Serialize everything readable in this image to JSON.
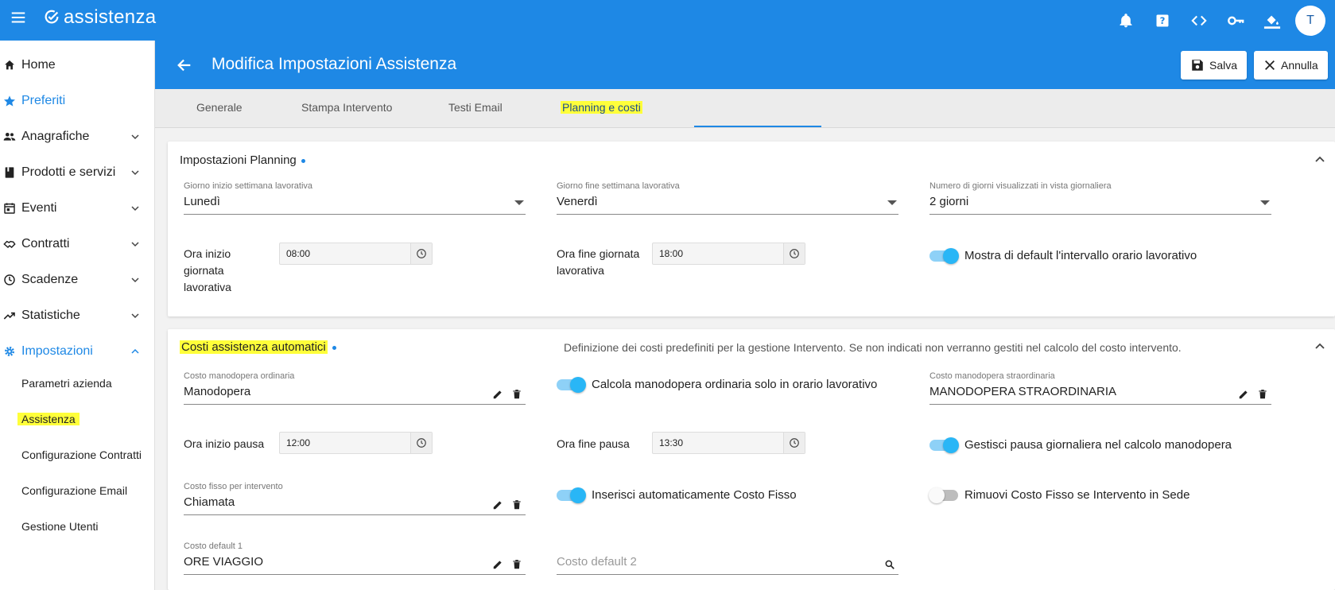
{
  "app": {
    "name": "assistenza",
    "user_initial": "T"
  },
  "sidebar": {
    "items": [
      {
        "label": "Home"
      },
      {
        "label": "Preferiti"
      },
      {
        "label": "Anagrafiche"
      },
      {
        "label": "Prodotti e servizi"
      },
      {
        "label": "Eventi"
      },
      {
        "label": "Contratti"
      },
      {
        "label": "Scadenze"
      },
      {
        "label": "Statistiche"
      },
      {
        "label": "Impostazioni"
      }
    ],
    "subitems": [
      {
        "label": "Parametri azienda"
      },
      {
        "label": "Assistenza"
      },
      {
        "label": "Configurazione Contratti"
      },
      {
        "label": "Configurazione Email"
      },
      {
        "label": "Gestione Utenti"
      }
    ]
  },
  "header": {
    "title": "Modifica Impostazioni Assistenza",
    "save_label": "Salva",
    "cancel_label": "Annulla"
  },
  "tabs": [
    {
      "label": "Generale"
    },
    {
      "label": "Stampa Intervento"
    },
    {
      "label": "Testi Email"
    },
    {
      "label": "Planning e costi"
    }
  ],
  "planning": {
    "title": "Impostazioni Planning",
    "start_day": {
      "label": "Giorno inizio settimana lavorativa",
      "value": "Lunedì"
    },
    "end_day": {
      "label": "Giorno fine settimana lavorativa",
      "value": "Venerdì"
    },
    "days_view": {
      "label": "Numero di giorni visualizzati in vista giornaliera",
      "value": "2 giorni"
    },
    "start_hour": {
      "label_1": "Ora inizio",
      "label_2": "giornata",
      "label_3": "lavorativa",
      "value": "08:00"
    },
    "end_hour": {
      "label_1": "Ora fine giornata",
      "label_2": "lavorativa",
      "value": "18:00"
    },
    "show_interval": {
      "label": "Mostra di default l'intervallo orario lavorativo"
    }
  },
  "costs": {
    "title": "Costi assistenza automatici",
    "description": "Definizione dei costi predefiniti per la gestione Intervento. Se non indicati non verranno gestiti nel calcolo del costo intervento.",
    "ordinary_labor": {
      "label": "Costo manodopera ordinaria",
      "value": "Manodopera"
    },
    "calc_ordinary": {
      "label": "Calcola manodopera ordinaria solo in orario lavorativo"
    },
    "overtime_labor": {
      "label": "Costo manodopera straordinaria",
      "value": "MANODOPERA STRAORDINARIA"
    },
    "break_start": {
      "label": "Ora inizio pausa",
      "value": "12:00"
    },
    "break_end": {
      "label": "Ora fine pausa",
      "value": "13:30"
    },
    "manage_break": {
      "label": "Gestisci pausa giornaliera nel calcolo manodopera"
    },
    "fixed_cost": {
      "label": "Costo fisso per intervento",
      "value": "Chiamata"
    },
    "auto_fixed": {
      "label": "Inserisci automaticamente Costo Fisso"
    },
    "remove_fixed": {
      "label": "Rimuovi Costo Fisso se Intervento in Sede"
    },
    "default1": {
      "label": "Costo default 1",
      "value": "ORE VIAGGIO"
    },
    "default2": {
      "placeholder": "Costo default 2"
    }
  },
  "colors": {
    "primary": "#1e88e5",
    "highlight": "#ffff3a",
    "toggle_on": "#29b6f6"
  }
}
